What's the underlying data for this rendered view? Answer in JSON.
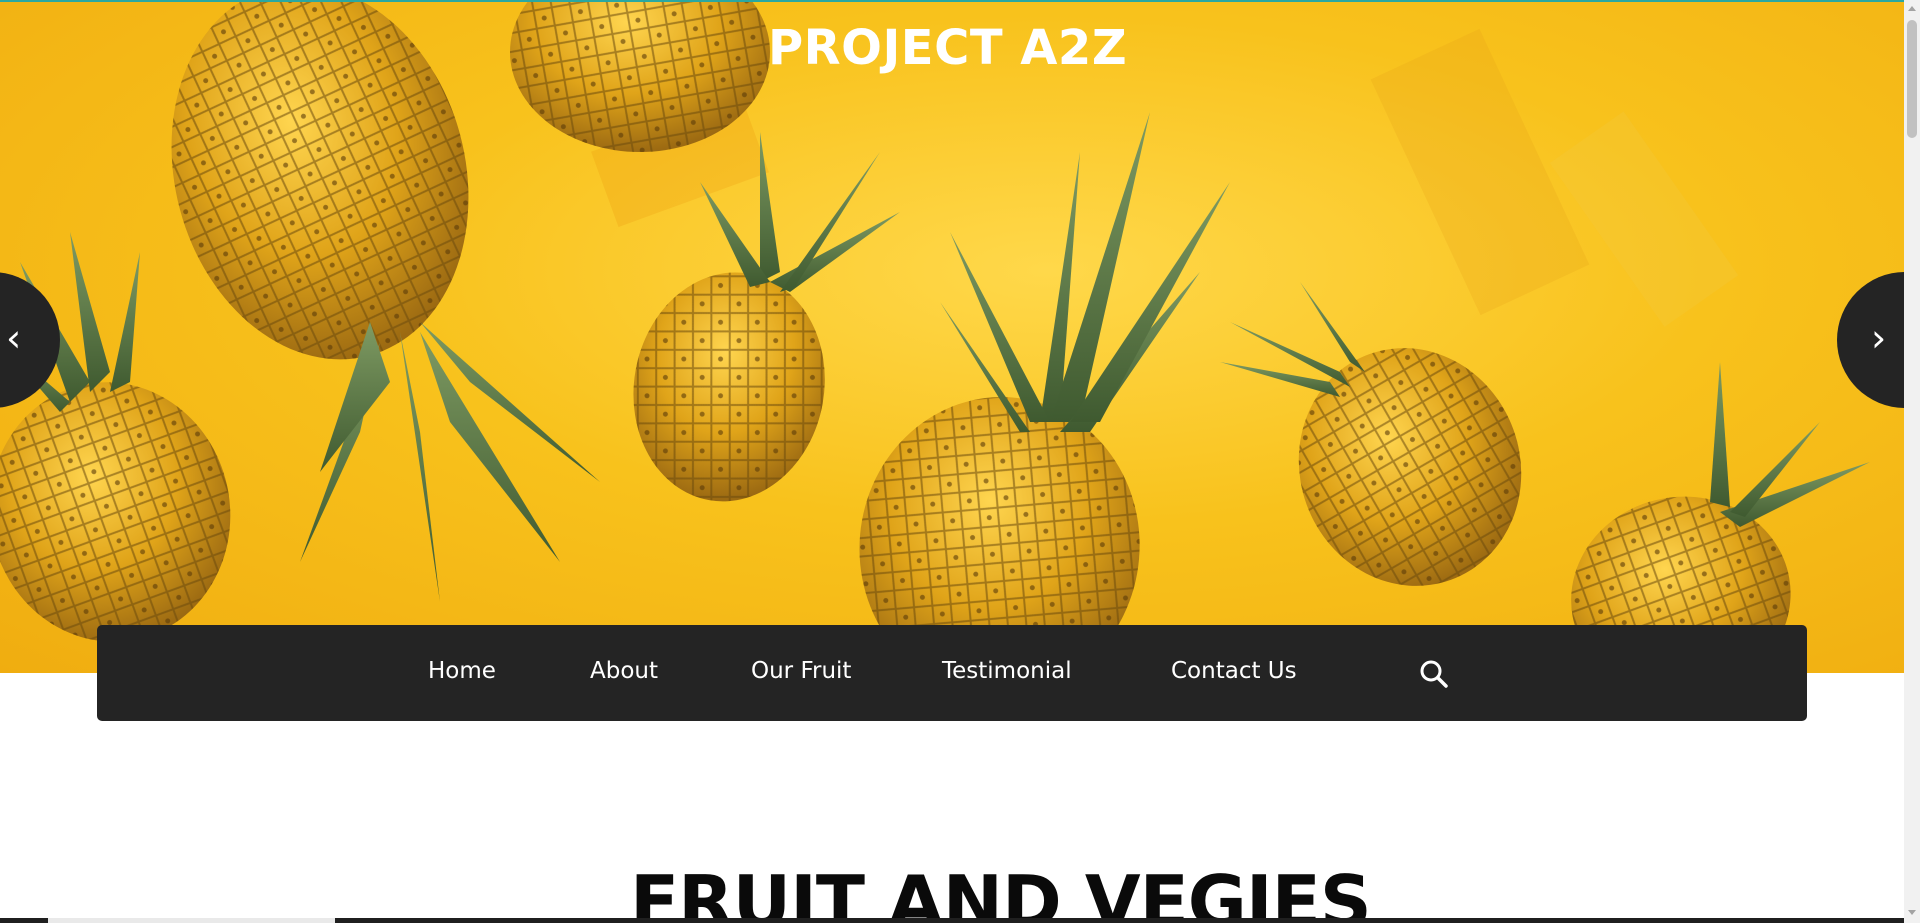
{
  "site": {
    "brand": "PROJECT A2Z"
  },
  "hero": {
    "image": "pineapples-on-yellow-background",
    "prev_icon": "chevron-left-icon",
    "next_icon": "chevron-right-icon",
    "prev_glyph": "‹",
    "next_glyph": "›"
  },
  "nav": {
    "items": [
      {
        "label": "Home"
      },
      {
        "label": "About"
      },
      {
        "label": "Our Fruit"
      },
      {
        "label": "Testimonial"
      },
      {
        "label": "Contact Us"
      }
    ],
    "search_icon": "search-icon"
  },
  "main": {
    "section_title": "FRUIT AND VEGIES"
  },
  "colors": {
    "hero_background": "#f8c21c",
    "nav_background": "#242424",
    "arrow_background": "#242424",
    "text_light": "#ffffff",
    "title_text": "#0a0a0a",
    "accent_line": "#2aa8a1"
  }
}
